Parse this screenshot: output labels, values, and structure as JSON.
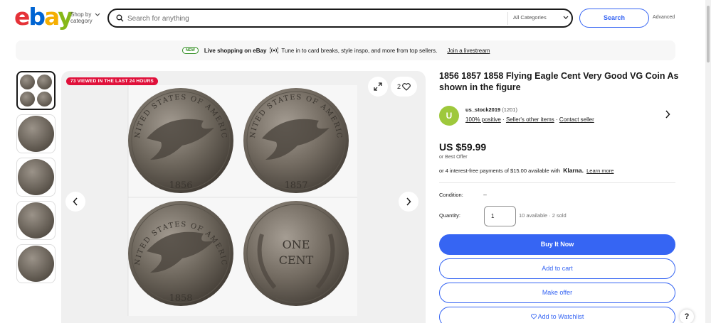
{
  "header": {
    "logo": {
      "e": "e",
      "b": "b",
      "a": "a",
      "y": "y"
    },
    "shop_by_category": "Shop by category",
    "search_placeholder": "Search for anything",
    "category_select": "All Categories",
    "search_button": "Search",
    "advanced": "Advanced"
  },
  "banner": {
    "badge": "NEW",
    "title": "Live shopping on eBay",
    "description": "Tune in to card breaks, style inspo, and more from top sellers.",
    "link": "Join a livestream"
  },
  "gallery": {
    "viewed_badge": "73 VIEWED IN THE LAST 24 HOURS",
    "watch_count": "2",
    "coin_texts": {
      "legend": "UNITED STATES OF AMERICA",
      "years": [
        "1856",
        "1857",
        "1858"
      ],
      "one": "ONE",
      "cent": "CENT"
    }
  },
  "item": {
    "title": "1856 1857 1858 Flying Eagle Cent Very Good VG Coin As shown in the figure",
    "seller": {
      "initial": "U",
      "name": "us_stock2019",
      "feedback_count": "(1201)",
      "positive": "100% positive",
      "sep": "·",
      "other_items": "Seller's other items",
      "contact": "Contact seller"
    },
    "price": "US $59.99",
    "best_offer": "or Best Offer",
    "installments": "or 4 interest-free payments of $15.00 available with",
    "klarna": "Klarna.",
    "learn_more": "Learn more",
    "condition_label": "Condition:",
    "condition_value": "--",
    "quantity_label": "Quantity:",
    "quantity_value": "1",
    "availability": "10 available · 2 sold",
    "buy_now": "Buy It Now",
    "add_to_cart": "Add to cart",
    "make_offer": "Make offer",
    "add_watchlist": "Add to Watchlist"
  },
  "help": "?",
  "colors": {
    "primary": "#3665f3",
    "badge_red": "#e0103a",
    "avatar_green": "#9ec83c"
  }
}
